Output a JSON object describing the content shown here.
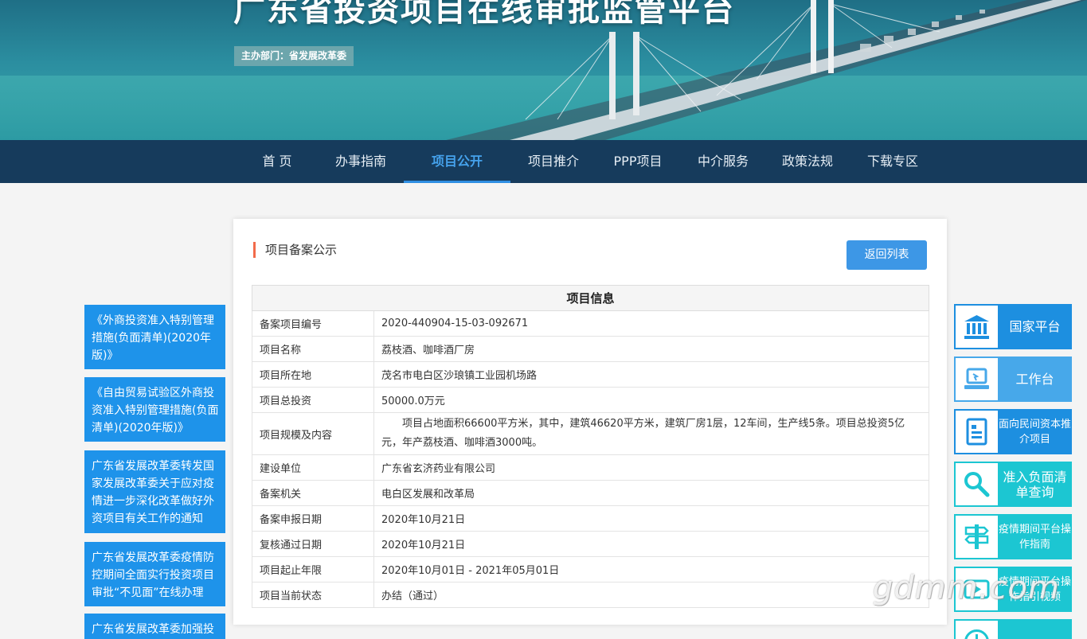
{
  "banner": {
    "title": "广东省投资项目在线审批监管平台",
    "host": "主办部门：省发展改革委"
  },
  "nav": {
    "items": [
      "首 页",
      "办事指南",
      "项目公开",
      "项目推介",
      "PPP项目",
      "中介服务",
      "政策法规",
      "下载专区"
    ],
    "active": "项目公开"
  },
  "left_links": [
    "《外商投资准入特别管理措施(负面清单)(2020年版)》",
    "《自由贸易试验区外商投资准入特别管理措施(负面清单)(2020年版)》",
    "广东省发展改革委转发国家发展改革委关于应对疫情进一步深化改革做好外资项目有关工作的通知",
    "广东省发展改革委疫情防控期间全面实行投资项目审批“不见面”在线办理",
    "广东省发展改革委加强投"
  ],
  "card": {
    "title": "项目备案公示",
    "back_button": "返回列表",
    "table_header": "项目信息",
    "rows": [
      {
        "label": "备案项目编号",
        "value": "2020-440904-15-03-092671"
      },
      {
        "label": "项目名称",
        "value": "荔枝酒、咖啡酒厂房"
      },
      {
        "label": "项目所在地",
        "value": "茂名市电白区沙琅镇工业园机场路"
      },
      {
        "label": "项目总投资",
        "value": "50000.0万元"
      },
      {
        "label": "项目规模及内容",
        "value": "项目占地面积66600平方米，其中，建筑46620平方米，建筑厂房1层，12车间，生产线5条。项目总投资5亿元，年产荔枝酒、咖啡酒3000吨。"
      },
      {
        "label": "建设单位",
        "value": "广东省玄济药业有限公司"
      },
      {
        "label": "备案机关",
        "value": "电白区发展和改革局"
      },
      {
        "label": "备案申报日期",
        "value": "2020年10月21日"
      },
      {
        "label": "复核通过日期",
        "value": "2020年10月21日"
      },
      {
        "label": "项目起止年限",
        "value": "2020年10月01日 - 2021年05月01日"
      },
      {
        "label": "项目当前状态",
        "value": "办结（通过）"
      }
    ]
  },
  "right_tiles": [
    {
      "label": "国家平台",
      "icon": "government-building-icon",
      "color": "#1d8fe0"
    },
    {
      "label": "工作台",
      "icon": "computer-icon",
      "color": "#47a8ea"
    },
    {
      "label": "面向民间资本推介项目",
      "icon": "document-list-icon",
      "color": "#1d8fe0"
    },
    {
      "label": "准入负面清单查询",
      "icon": "search-icon",
      "color": "#1cc6d2"
    },
    {
      "label": "疫情期间平台操作指南",
      "icon": "signpost-icon",
      "color": "#1cc6d2"
    },
    {
      "label": "疫情期间平台操作指引视频",
      "icon": "video-icon",
      "color": "#1cc6d2"
    },
    {
      "label": "",
      "icon": "clock-icon",
      "color": "#1cc6d2"
    }
  ],
  "watermark": "gdmm.com"
}
